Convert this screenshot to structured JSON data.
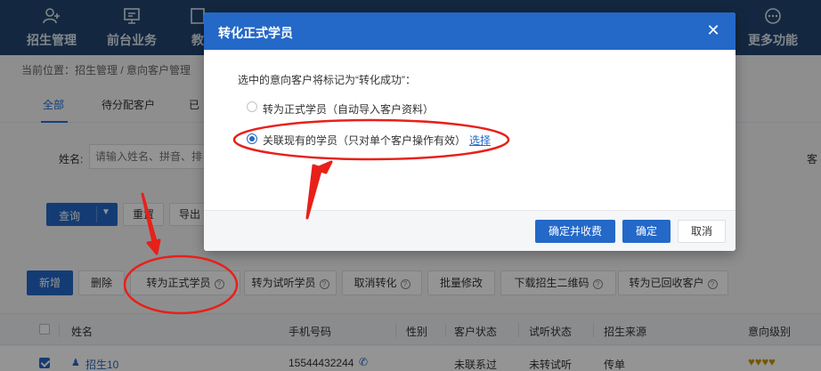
{
  "nav": [
    {
      "label": "招生管理",
      "icon": "add-user-icon"
    },
    {
      "label": "前台业务",
      "icon": "monitor-icon"
    },
    {
      "label": "教",
      "icon": "book-icon"
    },
    {
      "label": "更多功能",
      "icon": "more-icon"
    }
  ],
  "breadcrumb": "当前位置：招生管理 / 意向客户管理",
  "tabs": [
    "全部",
    "待分配客户",
    "已"
  ],
  "filter": {
    "name_label": "姓名:",
    "name_placeholder": "请输入姓名、拼音、排",
    "right_label": "客"
  },
  "buttons": {
    "query": "查询",
    "reset": "重置",
    "export": "导出"
  },
  "actions": {
    "add": "新增",
    "delete": "删除",
    "to_formal": "转为正式学员",
    "to_trial": "转为试听学员",
    "cancel_convert": "取消转化",
    "batch_edit": "批量修改",
    "download_qr": "下载招生二维码",
    "to_recycled": "转为已回收客户"
  },
  "table": {
    "headers": [
      "姓名",
      "手机号码",
      "性别",
      "客户状态",
      "试听状态",
      "招生来源",
      "意向级别"
    ],
    "row": {
      "name": "招生10",
      "phone": "15544432244",
      "status": "未联系过",
      "trial": "未转试听",
      "source": "传单",
      "level": "♥♥♥♥"
    }
  },
  "modal": {
    "title": "转化正式学员",
    "close": "✕",
    "prompt": "选中的意向客户将标记为“转化成功”：",
    "options": [
      {
        "label": "转为正式学员（自动导入客户资料）",
        "checked": false
      },
      {
        "label": "关联现有的学员（只对单个客户操作有效）",
        "checked": true
      }
    ],
    "select_link": "选择",
    "btn_confirm_pay": "确定并收费",
    "btn_confirm": "确定",
    "btn_cancel": "取消"
  },
  "colors": {
    "nav_bg": "#21466f",
    "primary": "#2468c8",
    "annotation": "#e8201a"
  }
}
